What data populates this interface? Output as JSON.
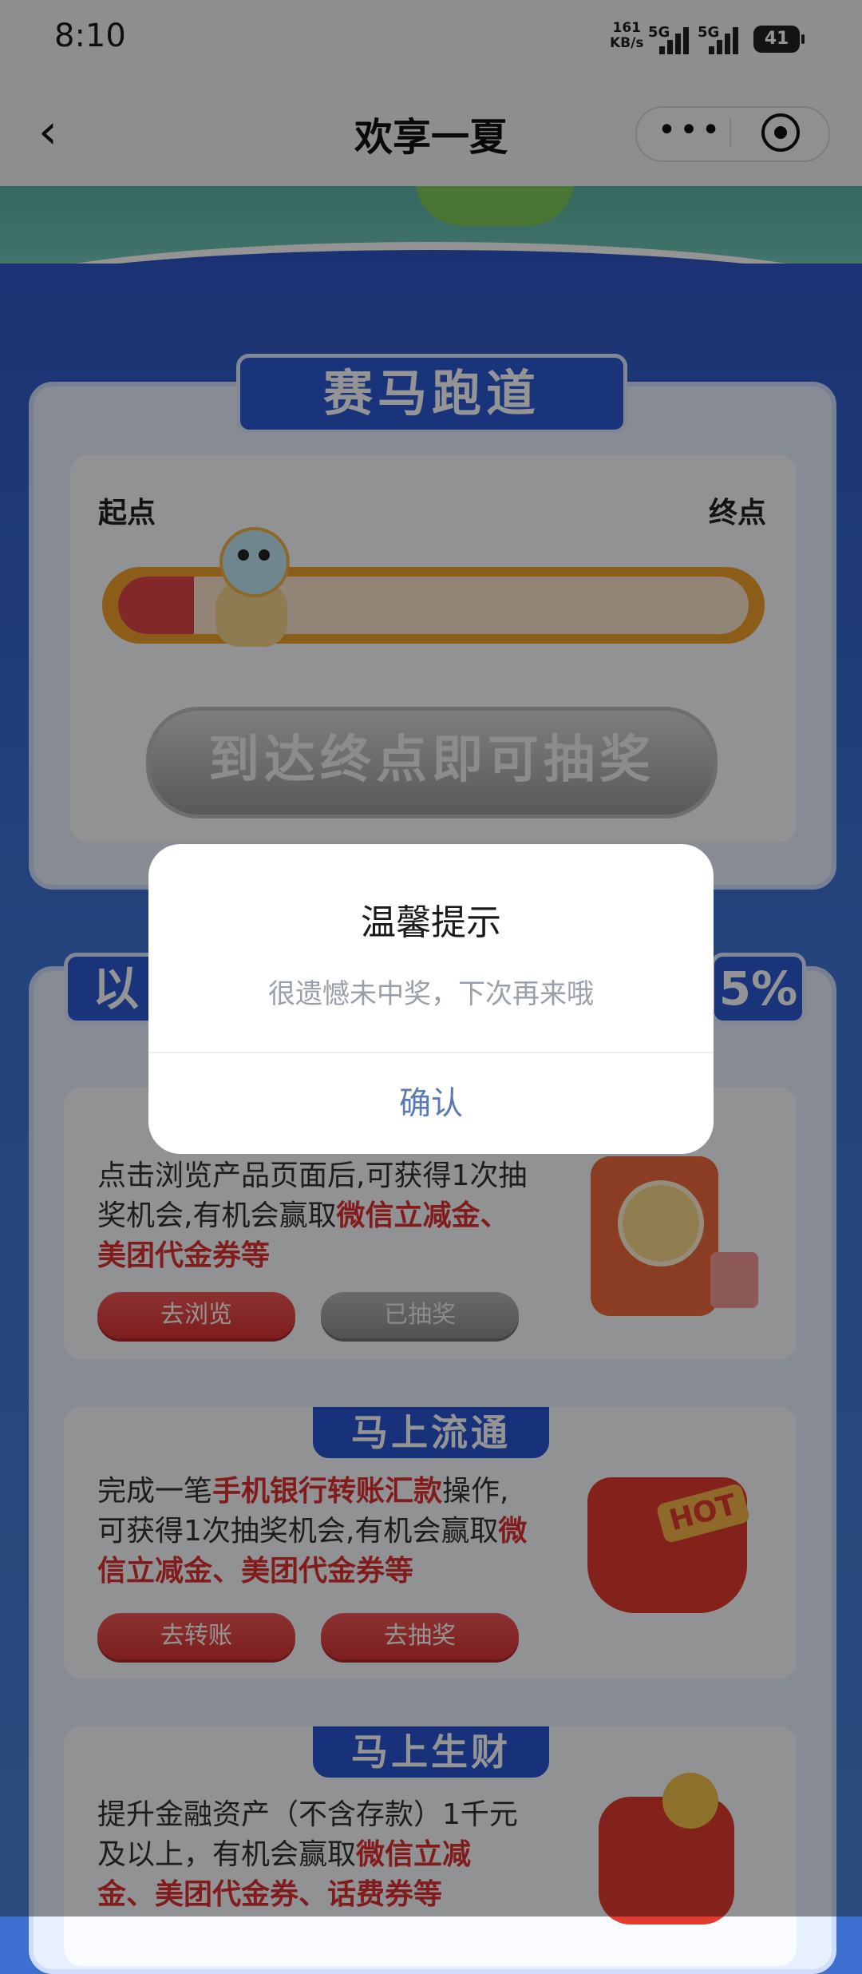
{
  "status_bar": {
    "time": "8:10",
    "net_speed_value": "161",
    "net_speed_unit": "KB/s",
    "signal1": "5G",
    "signal2": "5G",
    "battery": "41"
  },
  "nav": {
    "title": "欢享一夏",
    "more_label": "•••"
  },
  "race": {
    "section_title": "赛马跑道",
    "start_label": "起点",
    "end_label": "终点",
    "progress_fraction": 0.12,
    "reach_end_label": "到达终点即可抽奖"
  },
  "section2": {
    "title_left": "以",
    "title_right": "5%"
  },
  "cards": [
    {
      "title": "",
      "text_plain": "点击浏览产品页面后,可获得1次抽奖机会,有机会赢取",
      "text_highlight": "微信立减金、美团代金券等",
      "btn1": "去浏览",
      "btn2": "已抽奖"
    },
    {
      "title": "马上流通",
      "text_pre": "完成一笔",
      "text_highlight1": "手机银行转账汇款",
      "text_mid": "操作,可获得1次抽奖机会,有机会赢取",
      "text_highlight2": "微信立减金、美团代金券等",
      "btn1": "去转账",
      "btn2": "去抽奖",
      "badge": "HOT"
    },
    {
      "title": "马上生财",
      "text_plain": "提升金融资产（不含存款）1千元及以上，有机会赢取",
      "text_highlight": "微信立减金、美团代金券、话费券等"
    }
  ],
  "dialog": {
    "title": "温馨提示",
    "message": "很遗憾未中奖，下次再来哦",
    "confirm": "确认"
  },
  "colors": {
    "page_blue": "#3c6fd0",
    "highlight_red": "#e03131",
    "confirm_blue": "#5a7ab5"
  }
}
